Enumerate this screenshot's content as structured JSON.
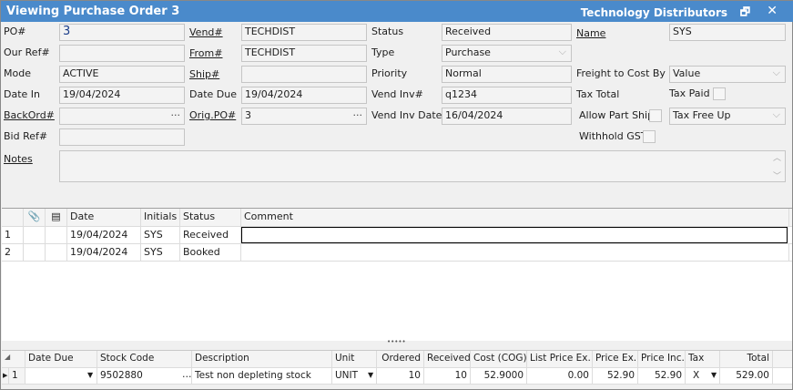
{
  "window": {
    "title": "Viewing Purchase Order 3",
    "vendor_name": "Technology Distributors",
    "restore_icon": "restore-icon",
    "close_icon": "close-icon"
  },
  "form": {
    "po": {
      "label": "PO#",
      "value": "3"
    },
    "our_ref": {
      "label": "Our Ref#",
      "value": ""
    },
    "mode": {
      "label": "Mode",
      "value": "ACTIVE"
    },
    "date_in": {
      "label": "Date In",
      "value": "19/04/2024"
    },
    "backord": {
      "label": "BackOrd#",
      "value": ""
    },
    "bid_ref": {
      "label": "Bid Ref#",
      "value": ""
    },
    "vend": {
      "label": "Vend#",
      "value": "TECHDIST"
    },
    "from": {
      "label": "From#",
      "value": "TECHDIST"
    },
    "ship": {
      "label": "Ship#",
      "value": ""
    },
    "date_due": {
      "label": "Date Due",
      "value": "19/04/2024"
    },
    "orig_po": {
      "label": "Orig.PO#",
      "value": "3"
    },
    "status": {
      "label": "Status",
      "value": "Received"
    },
    "type": {
      "label": "Type",
      "value": "Purchase"
    },
    "priority": {
      "label": "Priority",
      "value": "Normal"
    },
    "vend_inv": {
      "label": "Vend Inv#",
      "value": "q1234"
    },
    "vend_inv_date": {
      "label": "Vend Inv Date",
      "value": "16/04/2024"
    },
    "name": {
      "label": "Name",
      "value": "SYS"
    },
    "freight": {
      "label": "Freight to Cost By",
      "value": "Value"
    },
    "tax_total": {
      "label": "Tax Total"
    },
    "tax_paid": {
      "label": "Tax Paid",
      "checked": false
    },
    "allow_part_ship": {
      "label": "Allow Part Ship",
      "checked": false
    },
    "tax_code": {
      "value": "Tax Free Up"
    },
    "withhold_gst": {
      "label": "Withhold GST",
      "checked": false
    },
    "notes": {
      "label": "Notes",
      "value": ""
    }
  },
  "history": {
    "headers": [
      "",
      "",
      "",
      "Date",
      "Initials",
      "Status",
      "Comment"
    ],
    "rows": [
      {
        "num": "1",
        "date": "19/04/2024",
        "initials": "SYS",
        "status": "Received",
        "comment": ""
      },
      {
        "num": "2",
        "date": "19/04/2024",
        "initials": "SYS",
        "status": "Booked",
        "comment": ""
      }
    ]
  },
  "splitter": "•••••",
  "lines": {
    "headers": [
      "",
      "Date Due",
      "Stock Code",
      "Description",
      "Unit",
      "Ordered",
      "Received",
      "Cost (COG)",
      "List Price Ex.",
      "Price Ex.",
      "Price Inc.",
      "Tax",
      "Total"
    ],
    "rows": [
      {
        "num": "1",
        "date_due": "",
        "stock_code": "9502880",
        "description": "Test non depleting stock",
        "unit": "UNIT",
        "ordered": "10",
        "received": "10",
        "cost": "52.9000",
        "list_price": "0.00",
        "price_ex": "52.90",
        "price_inc": "52.90",
        "tax": "X",
        "total": "529.00"
      }
    ]
  }
}
